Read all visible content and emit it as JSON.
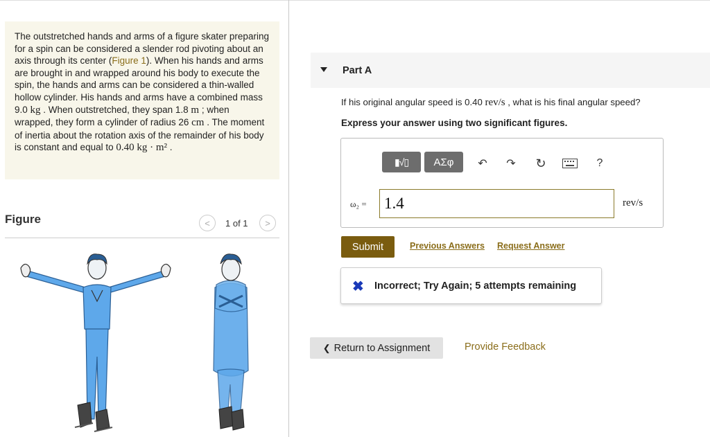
{
  "problem": {
    "segments": [
      {
        "text": "The outstretched hands and arms of a figure skater preparing for a spin can be considered a slender rod pivoting about an axis through its center (",
        "style": "normal"
      },
      {
        "text": "Figure 1",
        "style": "link"
      },
      {
        "text": "). When his hands and arms are brought in and wrapped around his body to execute the spin, the hands and arms can be considered a thin-walled hollow cylinder. His hands and arms have a combined mass 9.0 ",
        "style": "normal"
      },
      {
        "text": "kg",
        "style": "serif"
      },
      {
        "text": " . When outstretched, they span 1.8 ",
        "style": "normal"
      },
      {
        "text": "m",
        "style": "serif"
      },
      {
        "text": " ; when wrapped, they form a cylinder of radius 26 ",
        "style": "normal"
      },
      {
        "text": "cm",
        "style": "serif"
      },
      {
        "text": " . The moment of inertia about the rotation axis of the remainder of his body is constant and equal to ",
        "style": "normal"
      },
      {
        "text": "0.40 kg · m²",
        "style": "serif"
      },
      {
        "text": " .",
        "style": "normal"
      }
    ]
  },
  "figure": {
    "title": "Figure",
    "pager_text": "1 of 1",
    "prev_glyph": "<",
    "next_glyph": ">"
  },
  "part": {
    "title": "Part A",
    "question_pre": "If his original angular speed is 0.40 ",
    "question_unit": "rev/s",
    "question_post": " , what is his final angular speed?",
    "instruction": "Express your answer using two significant figures."
  },
  "toolbar": {
    "templates_glyph": "▮√▯",
    "symbols_label": "ΑΣφ",
    "undo_glyph": "↶",
    "redo_glyph": "↷",
    "reset_glyph": "↻",
    "help_glyph": "?"
  },
  "answer": {
    "variable": "ω₂ =",
    "value": "1.4",
    "unit": "rev/s"
  },
  "actions": {
    "submit": "Submit",
    "previous_answers": "Previous Answers",
    "request_answer": "Request Answer"
  },
  "feedback": {
    "mark": "✖",
    "text": "Incorrect; Try Again; 5 attempts remaining"
  },
  "footer": {
    "return_glyph": "❮",
    "return_label": "Return to Assignment",
    "provide_feedback": "Provide Feedback"
  },
  "colors": {
    "accent": "#7a5c0f",
    "link": "#8a6d1a",
    "incorrect": "#1a3ab8",
    "skater_body": "#5ea8ea"
  }
}
